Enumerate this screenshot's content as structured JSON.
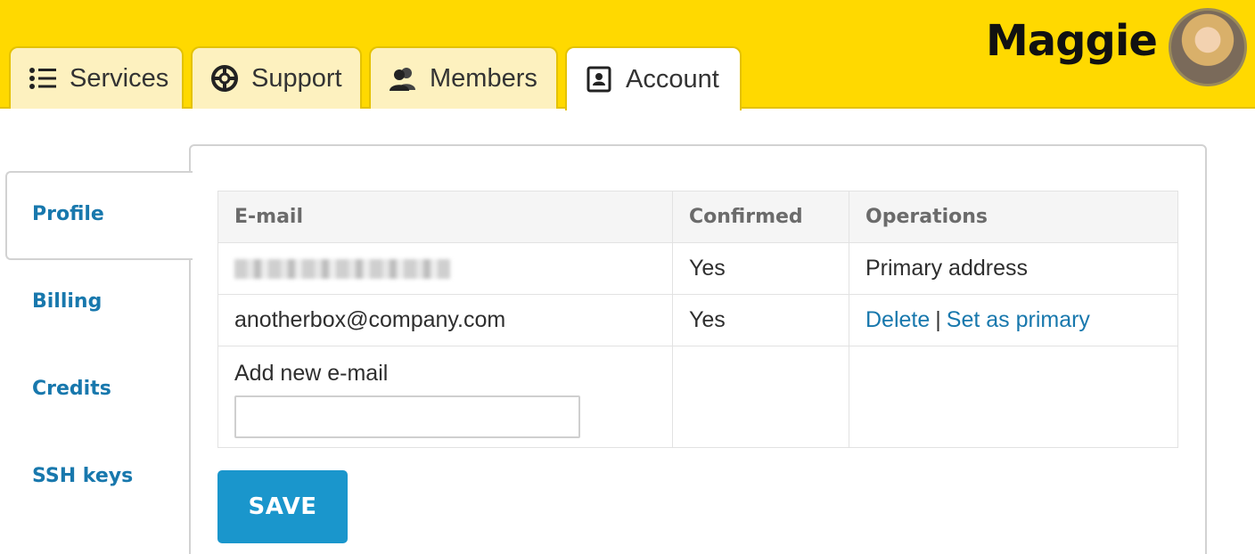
{
  "header": {
    "tabs": [
      {
        "label": "Services",
        "icon": "list-icon"
      },
      {
        "label": "Support",
        "icon": "lifebuoy-icon"
      },
      {
        "label": "Members",
        "icon": "users-icon"
      },
      {
        "label": "Account",
        "icon": "contact-card-icon",
        "active": true
      }
    ],
    "user_name": "Maggie"
  },
  "sidebar": {
    "items": [
      {
        "label": "Profile",
        "active": true
      },
      {
        "label": "Billing"
      },
      {
        "label": "Credits"
      },
      {
        "label": "SSH keys"
      }
    ]
  },
  "emails_table": {
    "columns": [
      "E-mail",
      "Confirmed",
      "Operations"
    ],
    "rows": [
      {
        "email": "",
        "email_redacted": true,
        "confirmed": "Yes",
        "operation": "Primary address"
      },
      {
        "email": "anotherbox@company.com",
        "confirmed": "Yes",
        "delete_label": "Delete",
        "separator": "|",
        "set_primary_label": "Set as primary"
      }
    ],
    "add_label": "Add new e-mail",
    "add_value": ""
  },
  "save_label": "SAVE",
  "colors": {
    "brand_yellow": "#ffd900",
    "link_blue": "#1878ad",
    "button_blue": "#1a96cc"
  }
}
